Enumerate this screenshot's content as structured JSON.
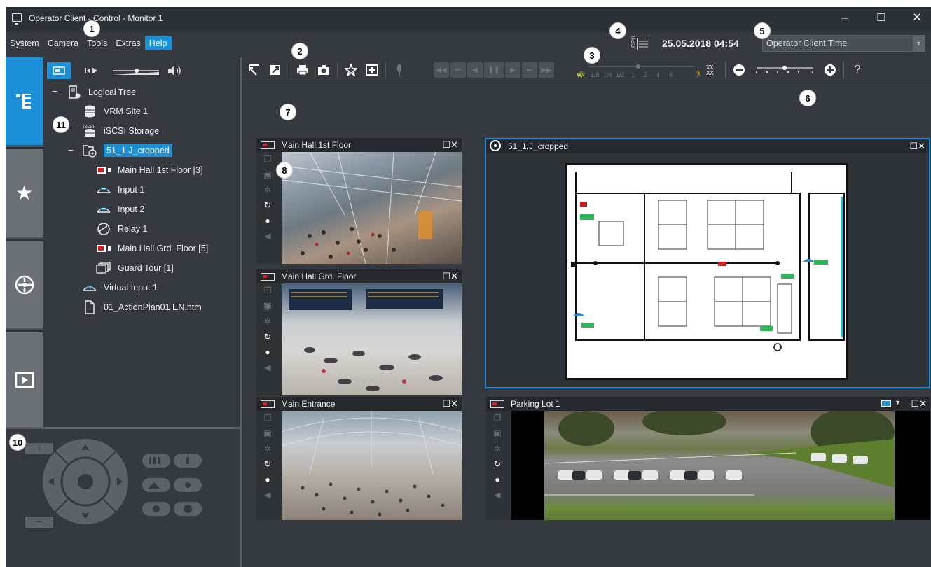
{
  "window": {
    "title": "Operator Client - Control - Monitor 1",
    "minimize": "–",
    "maximize": "☐",
    "close": "✕"
  },
  "menu": [
    "System",
    "Camera",
    "Tools",
    "Extras",
    "Help"
  ],
  "status": {
    "cpu_label": "CPU",
    "datetime": "25.05.2018 04:54",
    "time_mode": "Operator Client Time"
  },
  "tree": {
    "root": "Logical Tree",
    "items": [
      {
        "label": "VRM Site 1",
        "icon": "database-icon"
      },
      {
        "label": "iSCSI Storage",
        "icon": "iscsi-storage-icon"
      },
      {
        "label": "51_1.J_cropped",
        "icon": "map-folder-icon"
      },
      {
        "label": "Main Hall 1st Floor [3]",
        "icon": "camera-icon"
      },
      {
        "label": "Input 1",
        "icon": "input-icon"
      },
      {
        "label": "Input 2",
        "icon": "input-icon"
      },
      {
        "label": "Relay 1",
        "icon": "relay-icon"
      },
      {
        "label": "Main Hall Grd. Floor [5]",
        "icon": "camera-icon"
      },
      {
        "label": "Guard Tour [1]",
        "icon": "guard-tour-icon"
      },
      {
        "label": "Virtual Input 1",
        "icon": "virtual-input-icon"
      },
      {
        "label": "01_ActionPlan01 EN.htm",
        "icon": "document-icon"
      }
    ]
  },
  "speed_labels": [
    "1/8",
    "1/4",
    "1/2",
    "1",
    "2",
    "4",
    "8"
  ],
  "help_label": "?",
  "tiles": {
    "t1": {
      "title": "Main Hall 1st Floor"
    },
    "t2": {
      "title": "51_1.J_cropped"
    },
    "t3": {
      "title": "Main Hall Grd. Floor"
    },
    "t4": {
      "title": "Main Entrance"
    },
    "t5": {
      "title": "Parking Lot 1"
    }
  },
  "callouts": [
    "1",
    "2",
    "3",
    "4",
    "5",
    "6",
    "7",
    "8",
    "10",
    "11"
  ]
}
